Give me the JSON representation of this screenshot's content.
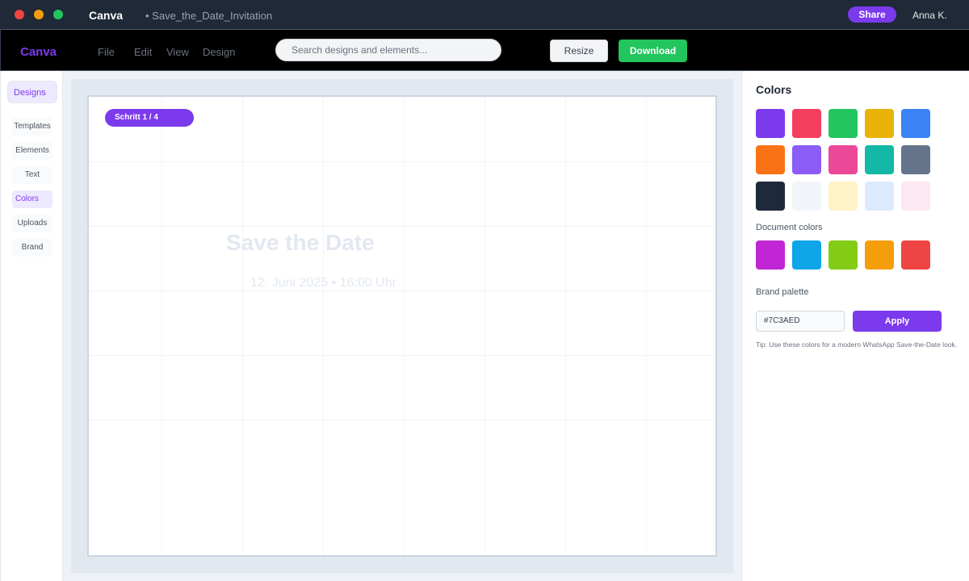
{
  "titlebar": {
    "app_name": "Canva",
    "document_name": "• Save_the_Date_Invitation",
    "share_label": "Share",
    "user_name": "Anna K."
  },
  "toolbar": {
    "logo": "Canva",
    "menu": [
      "File",
      "Edit",
      "View",
      "Design"
    ],
    "search_placeholder": "Search designs and elements...",
    "resize_label": "Resize",
    "download_label": "Download"
  },
  "sidebar": {
    "designs_label": "Designs",
    "items": [
      {
        "label": "Templates",
        "active": false
      },
      {
        "label": "Elements",
        "active": false
      },
      {
        "label": "Text",
        "active": false
      },
      {
        "label": "Colors",
        "active": true
      },
      {
        "label": "Uploads",
        "active": false
      },
      {
        "label": "Brand",
        "active": false
      }
    ]
  },
  "canvas": {
    "step_badge": "Schritt 1 / 4",
    "title": "Save the Date",
    "date_line": "12. Juni 2025 • 16:00 Uhr"
  },
  "colors_panel": {
    "title": "Colors",
    "palette": [
      "#7C3AED",
      "#F43F5E",
      "#22C55E",
      "#EAB308",
      "#3B82F6",
      "#F97316",
      "#8B5CF6",
      "#EC4899",
      "#14B8A6",
      "#64748B",
      "#1E293B",
      "#F1F5F9",
      "#FEF3C7",
      "#DBEAFE",
      "#FCE7F3"
    ],
    "document_colors_label": "Document colors",
    "document_colors": [
      "#C026D3",
      "#0EA5E9",
      "#84CC16",
      "#F59E0B",
      "#EF4444"
    ],
    "brand_palette_label": "Brand palette",
    "hex_value": "#7C3AED",
    "apply_label": "Apply",
    "tip": "Tip: Use these colors for a modern WhatsApp Save-the-Date look."
  }
}
